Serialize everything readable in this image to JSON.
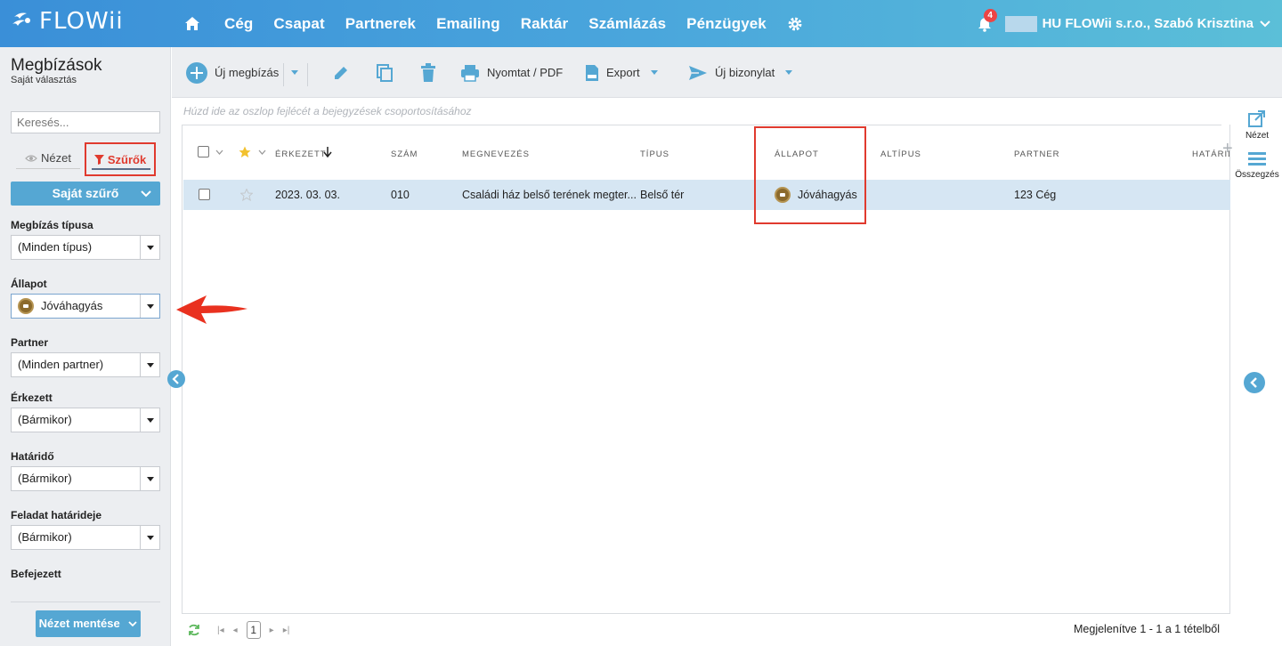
{
  "header": {
    "logo_text": "FLOWii",
    "nav": [
      "Cég",
      "Csapat",
      "Partnerek",
      "Emailing",
      "Raktár",
      "Számlázás",
      "Pénzügyek"
    ],
    "notification_count": "4",
    "user": "HU FLOWii s.r.o., Szabó Krisztina",
    "accent_color": "#4aa6dc"
  },
  "sidebar": {
    "title": "Megbízások",
    "subtitle": "Saját választás",
    "search_placeholder": "Keresés...",
    "tab_view": "Nézet",
    "tab_filters": "Szűrők",
    "own_filter": "Saját szűrő",
    "filters": [
      {
        "label": "Megbízás típusa",
        "value": "(Minden típus)"
      },
      {
        "label": "Állapot",
        "value": "Jóváhagyás"
      },
      {
        "label": "Partner",
        "value": "(Minden partner)"
      },
      {
        "label": "Érkezett",
        "value": "(Bármikor)"
      },
      {
        "label": "Határidő",
        "value": "(Bármikor)"
      },
      {
        "label": "Feladat határideje",
        "value": "(Bármikor)"
      },
      {
        "label": "Befejezett",
        "value": ""
      }
    ],
    "save_view": "Nézet mentése"
  },
  "toolbar": {
    "new_order": "Új megbízás",
    "print": "Nyomtat / PDF",
    "export": "Export",
    "new_document": "Új bizonylat"
  },
  "grid": {
    "group_hint": "Húzd ide az oszlop fejlécét a bejegyzések csoportosításához",
    "columns": [
      "Érkezett",
      "Szám",
      "Megnevezés",
      "Típus",
      "Állapot",
      "Altípus",
      "Partner",
      "Határidő"
    ],
    "rows": [
      {
        "received": "2023. 03. 03.",
        "number": "010",
        "name": "Családi ház belső terének megter...",
        "type": "Belső tér",
        "status": "Jóváhagyás",
        "subtype": "",
        "partner": "123 Cég"
      }
    ],
    "page": "1",
    "footer_info": "Megjelenítve 1 - 1 a 1 tételből"
  },
  "rail": {
    "view": "Nézet",
    "summary": "Összegzés"
  },
  "colors": {
    "highlight": "#e03a2e",
    "button": "#55a7d3",
    "row_selected": "#d6e6f3"
  }
}
